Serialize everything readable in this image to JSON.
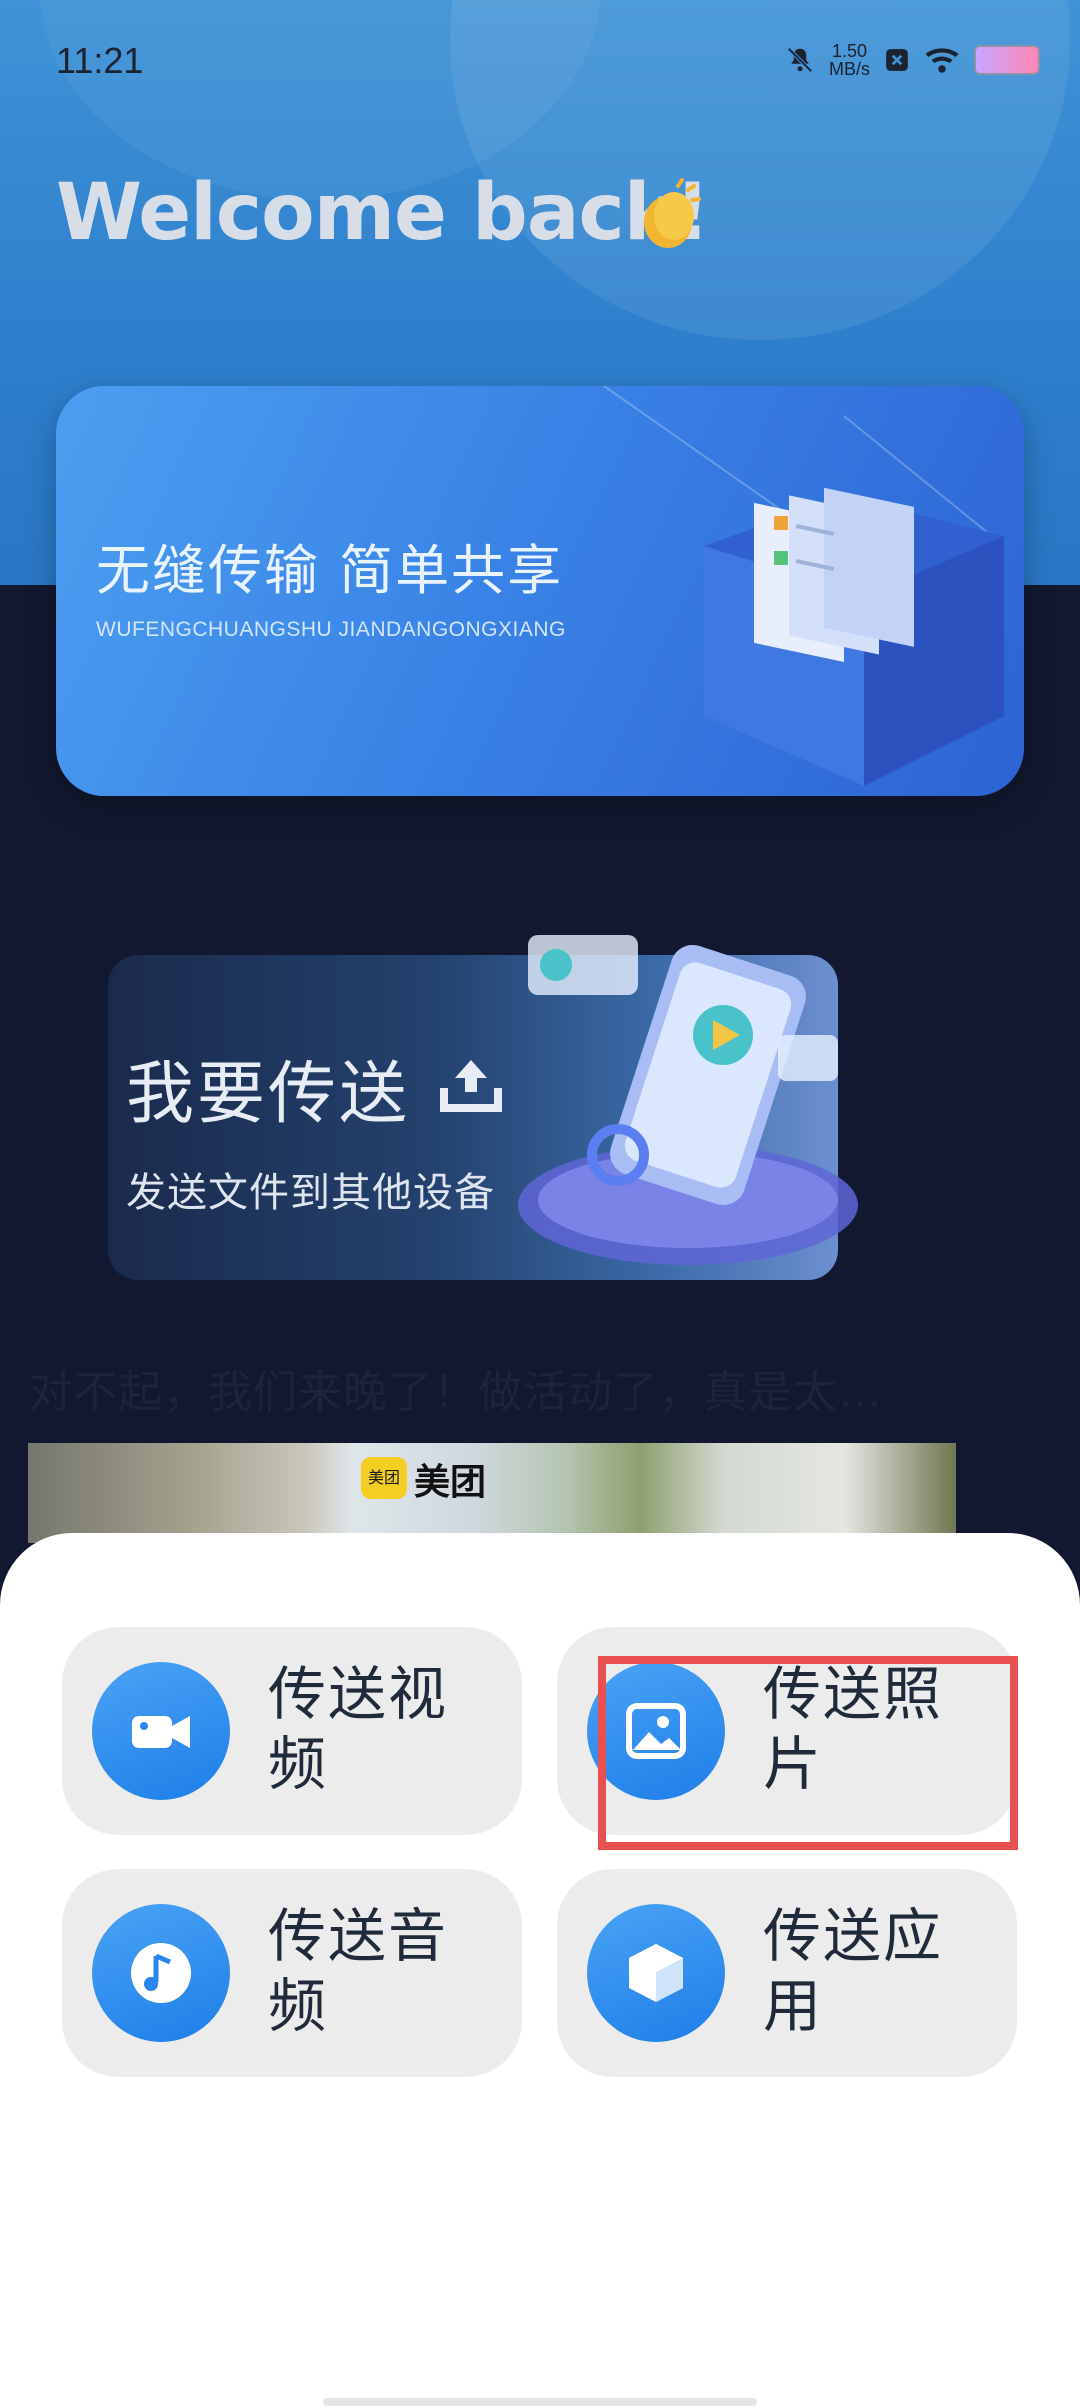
{
  "status_bar": {
    "time": "11:21",
    "net_speed_value": "1.50",
    "net_speed_unit": "MB/s"
  },
  "welcome": {
    "text": "Welcome back!",
    "emoji_icon": "clapping-hands-icon"
  },
  "banner": {
    "title": "无缝传输 简单共享",
    "subtitle": "WUFENGCHUANGSHU JIANDANGONGXIANG"
  },
  "send_card": {
    "title": "我要传送",
    "subtitle": "发送文件到其他设备",
    "icon": "upload-icon"
  },
  "ad": {
    "text": "对不起，我们来晚了！做活动了，真是太…",
    "brand_badge": "美团",
    "brand_text": "美团"
  },
  "sheet": {
    "options": [
      {
        "label": "传送视频",
        "icon": "video-camera-icon"
      },
      {
        "label": "传送照片",
        "icon": "photo-icon"
      },
      {
        "label": "传送音频",
        "icon": "music-note-icon"
      },
      {
        "label": "传送应用",
        "icon": "app-cube-icon"
      }
    ]
  },
  "colors": {
    "accent": "#2b86ec",
    "highlight": "#e9504f",
    "sheet_bg": "#ffffff",
    "option_bg": "#ececec"
  }
}
